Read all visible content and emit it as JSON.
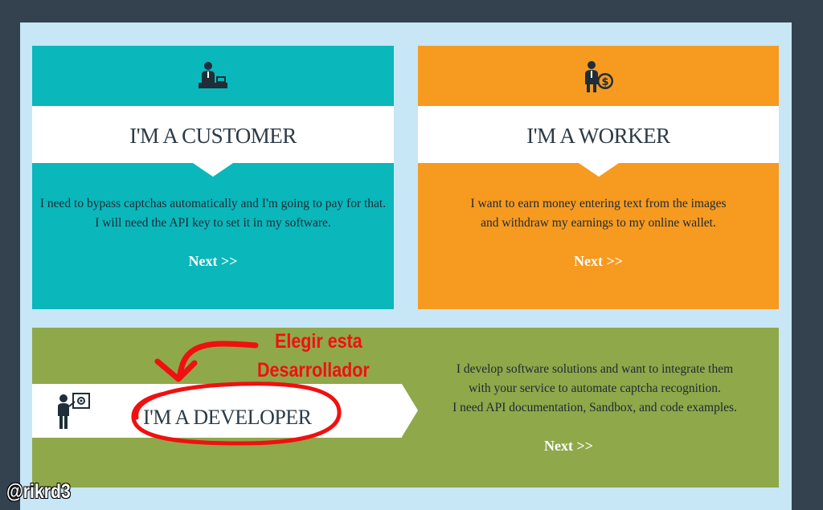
{
  "customer": {
    "title": "I'M A CUSTOMER",
    "desc_line1": "I need to bypass captchas automatically and I'm going to pay for that.",
    "desc_line2": "I will need the API key to set it in my software.",
    "next": "Next >>",
    "icon": "customer-desk-icon",
    "color": "#0ab7bb"
  },
  "worker": {
    "title": "I'M A WORKER",
    "desc_line1": "I want to earn money entering text from the images",
    "desc_line2": "and withdraw my earnings to my online wallet.",
    "next": "Next >>",
    "icon": "worker-money-icon",
    "color": "#f79a20"
  },
  "developer": {
    "title": "I'M A DEVELOPER",
    "desc_line1": "I develop software solutions and want to integrate them",
    "desc_line2": "with your service to automate captcha recognition.",
    "desc_line3": "I need API documentation, Sandbox, and code examples.",
    "next": "Next >>",
    "icon": "developer-presentation-icon",
    "color": "#8fa84a"
  },
  "annotation": {
    "line1": "Elegir esta",
    "line2": "Desarrollador",
    "color": "#f01010"
  },
  "watermark": "@rikrd3"
}
